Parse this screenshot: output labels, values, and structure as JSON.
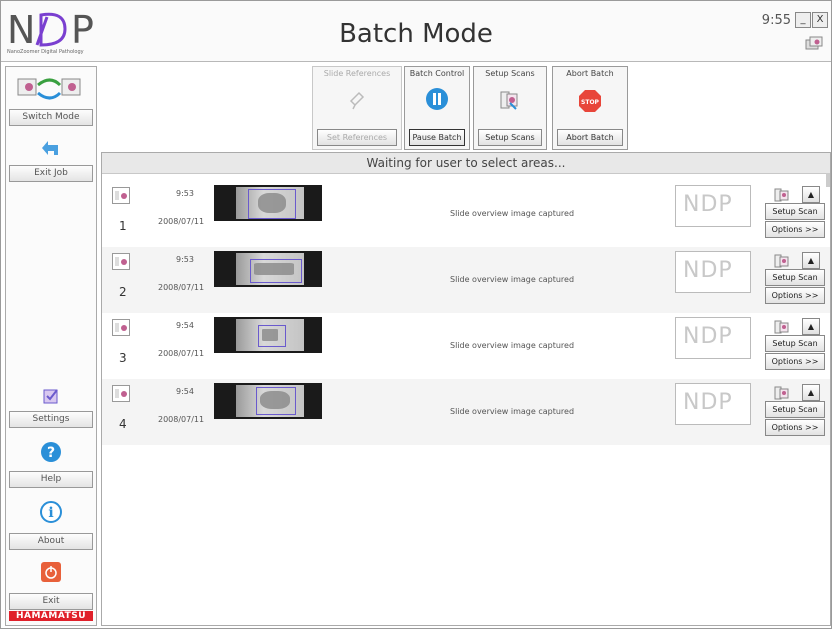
{
  "header": {
    "logo_text": "NDP",
    "logo_subtitle": "NanoZoomer Digital Pathology",
    "title": "Batch Mode",
    "clock": "9:55",
    "minimize_label": "_",
    "close_label": "X"
  },
  "sidebar": {
    "switch_mode": "Switch Mode",
    "exit_job": "Exit Job",
    "settings": "Settings",
    "help": "Help",
    "about": "About",
    "exit": "Exit",
    "brand": "HAMAMATSU"
  },
  "toolbar": {
    "slide_references_title": "Slide References",
    "slide_references_button": "Set References",
    "batch_control_title": "Batch Control",
    "batch_control_button": "Pause Batch",
    "setup_scans_title": "Setup Scans",
    "setup_scans_button": "Setup Scans",
    "abort_batch_title": "Abort Batch",
    "abort_batch_button": "Abort Batch",
    "stop_label": "STOP"
  },
  "main": {
    "status": "Waiting for user to select areas...",
    "setup_scan_label": "Setup Scan",
    "options_label": "Options >>",
    "slides": [
      {
        "number": "1",
        "time": "9:53",
        "date": "2008/07/11",
        "status": "Slide overview image captured"
      },
      {
        "number": "2",
        "time": "9:53",
        "date": "2008/07/11",
        "status": "Slide overview image captured"
      },
      {
        "number": "3",
        "time": "9:54",
        "date": "2008/07/11",
        "status": "Slide overview image captured"
      },
      {
        "number": "4",
        "time": "9:54",
        "date": "2008/07/11",
        "status": "Slide overview image captured"
      }
    ]
  },
  "colors": {
    "brand_red": "#e0202a",
    "accent_blue": "#2a8fd8",
    "selection_purple": "#6a5acd",
    "stop_red": "#e8463a"
  }
}
